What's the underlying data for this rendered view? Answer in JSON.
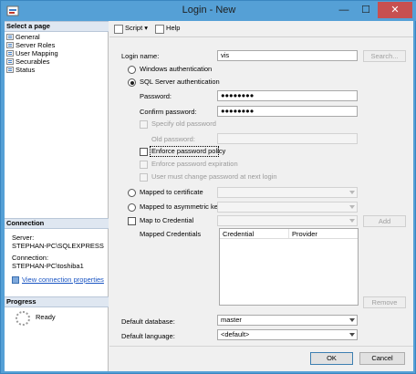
{
  "window": {
    "title": "Login - New",
    "minimize": "—",
    "maximize": "☐",
    "close": "✕"
  },
  "left_panel": {
    "select_page_header": "Select a page",
    "pages": [
      "General",
      "Server Roles",
      "User Mapping",
      "Securables",
      "Status"
    ],
    "connection_header": "Connection",
    "server_label": "Server:",
    "server_value": "STEPHAN-PC\\SQLEXPRESS",
    "connection_label": "Connection:",
    "connection_value": "STEPHAN-PC\\toshiba1",
    "view_connection_properties": "View connection properties",
    "progress_header": "Progress",
    "progress_status": "Ready"
  },
  "toolbar": {
    "script_label": "Script",
    "help_label": "Help"
  },
  "form": {
    "login_name_label": "Login name:",
    "login_name_value": "vis",
    "search_button": "Search...",
    "windows_auth": "Windows authentication",
    "sql_auth": "SQL Server authentication",
    "password_label": "Password:",
    "password_value": "●●●●●●●●",
    "confirm_password_label": "Confirm password:",
    "confirm_password_value": "●●●●●●●●",
    "specify_old_password": "Specify old password",
    "old_password_label": "Old password:",
    "enforce_policy": "Enforce password policy",
    "enforce_expiration": "Enforce password expiration",
    "must_change": "User must change password at next login",
    "mapped_certificate": "Mapped to certificate",
    "mapped_asym_key": "Mapped to asymmetric key",
    "map_to_credential": "Map to Credential",
    "add_button": "Add",
    "mapped_credentials_label": "Mapped Credentials",
    "credentials_columns": [
      "Credential",
      "Provider"
    ],
    "remove_button": "Remove",
    "default_database_label": "Default database:",
    "default_database_value": "master",
    "default_language_label": "Default language:",
    "default_language_value": "<default>"
  },
  "footer": {
    "ok_button": "OK",
    "cancel_button": "Cancel"
  },
  "colors": {
    "title_bar": "#55a0d6",
    "close_button": "#c75050",
    "section_header": "#dfe7f1",
    "link": "#1a55c3"
  }
}
